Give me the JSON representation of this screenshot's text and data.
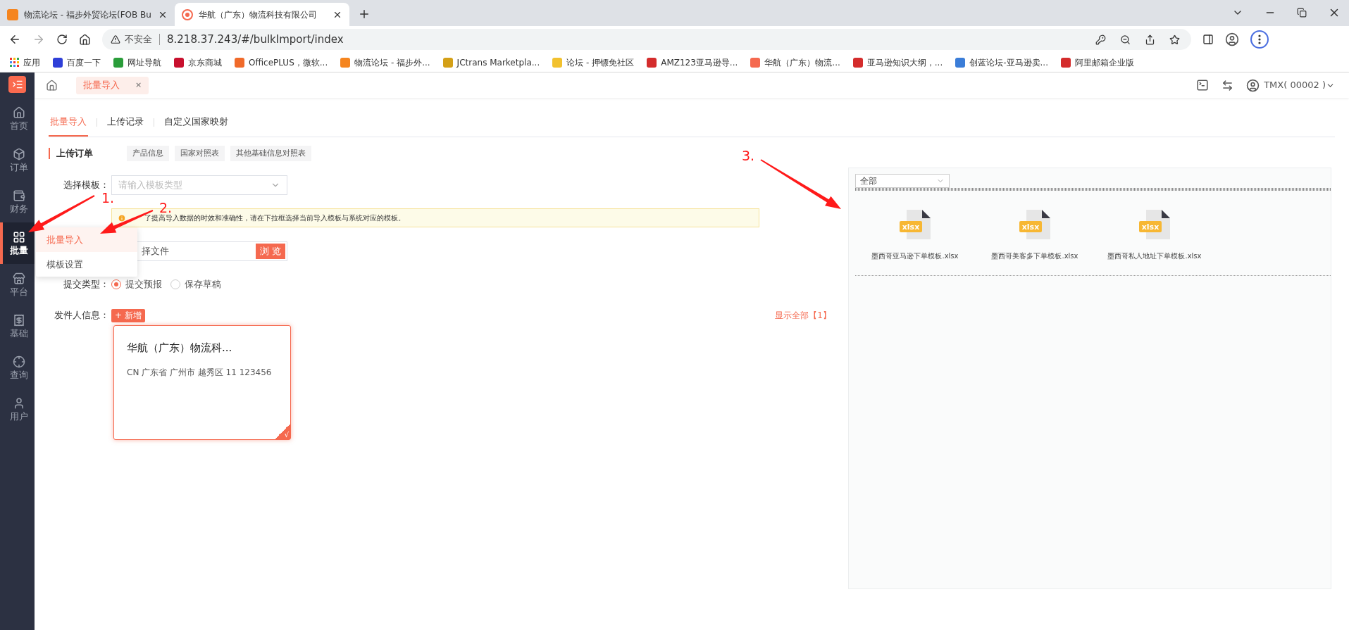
{
  "browser": {
    "tabs": [
      {
        "title": "物流论坛 - 福步外贸论坛(FOB Bu",
        "selected": false
      },
      {
        "title": "华航（广东）物流科技有限公司",
        "selected": true
      }
    ],
    "security": "不安全",
    "url": "8.218.37.243/#/bulkImport/index",
    "bookmarks": [
      "应用",
      "百度一下",
      "网址导航",
      "京东商城",
      "OfficePLUS，微软...",
      "物流论坛 - 福步外...",
      "JCtrans Marketpla...",
      "论坛 - 押镖免社区",
      "AMZ123亚马逊导...",
      "华航（广东）物流...",
      "亚马逊知识大纲，...",
      "创蓝论坛-亚马逊卖...",
      "阿里邮箱企业版"
    ]
  },
  "sidebar": {
    "items": [
      {
        "label": "首页",
        "selected": false
      },
      {
        "label": "订单",
        "selected": false
      },
      {
        "label": "财务",
        "selected": false
      },
      {
        "label": "批量",
        "selected": true
      },
      {
        "label": "平台",
        "selected": false
      },
      {
        "label": "基础",
        "selected": false
      },
      {
        "label": "查询",
        "selected": false
      },
      {
        "label": "用户",
        "selected": false
      }
    ]
  },
  "header": {
    "tabs": [
      {
        "label": "批量导入",
        "close": "×",
        "selected": true
      }
    ],
    "user": "TMX( 00002 )"
  },
  "page_tabs": [
    {
      "label": "批量导入",
      "selected": true
    },
    {
      "label": "上传记录",
      "selected": false
    },
    {
      "label": "自定义国家映射",
      "selected": false
    }
  ],
  "section": {
    "title": "上传订单",
    "chips": [
      "产品信息",
      "国家对照表",
      "其他基础信息对照表"
    ]
  },
  "form": {
    "template": {
      "label": "选择模板：",
      "placeholder": "请输入模板类型"
    },
    "notice": "了提高导入数据的时效和准确性，请在下拉框选择当前导入模板与系统对应的模板。",
    "file": {
      "value": "择文件",
      "button": "浏 览"
    },
    "submit_type": {
      "label": "提交类型：",
      "options": [
        {
          "label": "提交预报",
          "selected": true
        },
        {
          "label": "保存草稿",
          "selected": false
        }
      ]
    },
    "sender": {
      "label": "发件人信息：",
      "add_button": "+ 新增",
      "show_all": "显示全部【1】",
      "cards": [
        {
          "name": "华航（广东）物流科...",
          "address": "CN 广东省 广州市 越秀区 11 123456",
          "selected": true,
          "mark": "√"
        }
      ]
    }
  },
  "template_panel": {
    "filter": "全部",
    "files": [
      {
        "name": "墨西哥亚马逊下单模板.xlsx",
        "type": "xlsx"
      },
      {
        "name": "墨西哥美客多下单模板.xlsx",
        "type": "xlsx"
      },
      {
        "name": "墨西哥私人地址下单模板.xlsx",
        "type": "xlsx"
      }
    ]
  },
  "dropdown_menu": {
    "items": [
      {
        "label": "批量导入",
        "selected": true
      },
      {
        "label": "模板设置",
        "selected": false
      }
    ]
  },
  "annotations": [
    {
      "label": "1."
    },
    {
      "label": "2."
    },
    {
      "label": "3."
    }
  ]
}
